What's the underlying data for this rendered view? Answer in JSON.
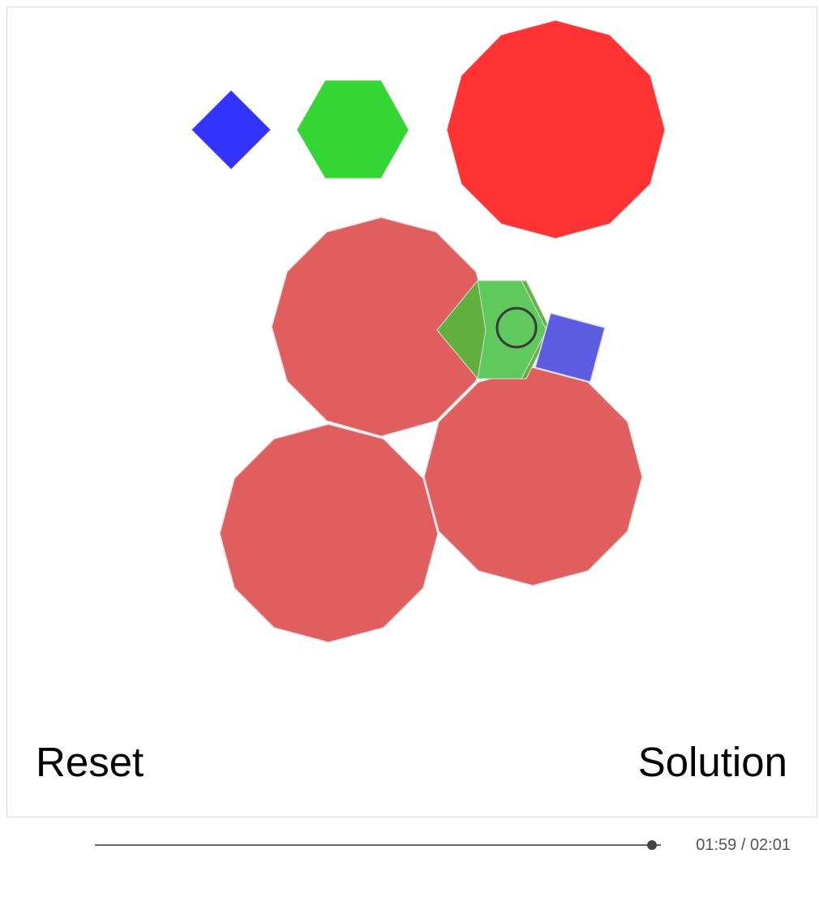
{
  "buttons": {
    "reset_label": "Reset",
    "solution_label": "Solution"
  },
  "player": {
    "time_display": "01:59 / 02:01",
    "elapsed": "01:59",
    "total": "02:01",
    "progress": 0.984
  },
  "pieces": {
    "palette": [
      {
        "name": "palette-square",
        "shape": "square",
        "color": "#3333ff"
      },
      {
        "name": "palette-hexagon",
        "shape": "hexagon",
        "color": "#33d633"
      },
      {
        "name": "palette-dodecagon",
        "shape": "dodecagon",
        "color": "#ff3333"
      }
    ],
    "placed": [
      {
        "name": "placed-dodecagon-1",
        "shape": "dodecagon",
        "color": "#e05e5e"
      },
      {
        "name": "placed-dodecagon-2",
        "shape": "dodecagon",
        "color": "#e05e5e"
      },
      {
        "name": "placed-dodecagon-3",
        "shape": "dodecagon",
        "color": "#e05e5e"
      },
      {
        "name": "placed-hexagon-1",
        "shape": "hexagon",
        "color": "#5ab33a"
      },
      {
        "name": "placed-hexagon-2",
        "shape": "hexagon",
        "color": "#5fc95f"
      },
      {
        "name": "placed-square-1",
        "shape": "square",
        "color": "#5c5ce0"
      }
    ],
    "cursor_ring_color": "#3a3a3a"
  }
}
